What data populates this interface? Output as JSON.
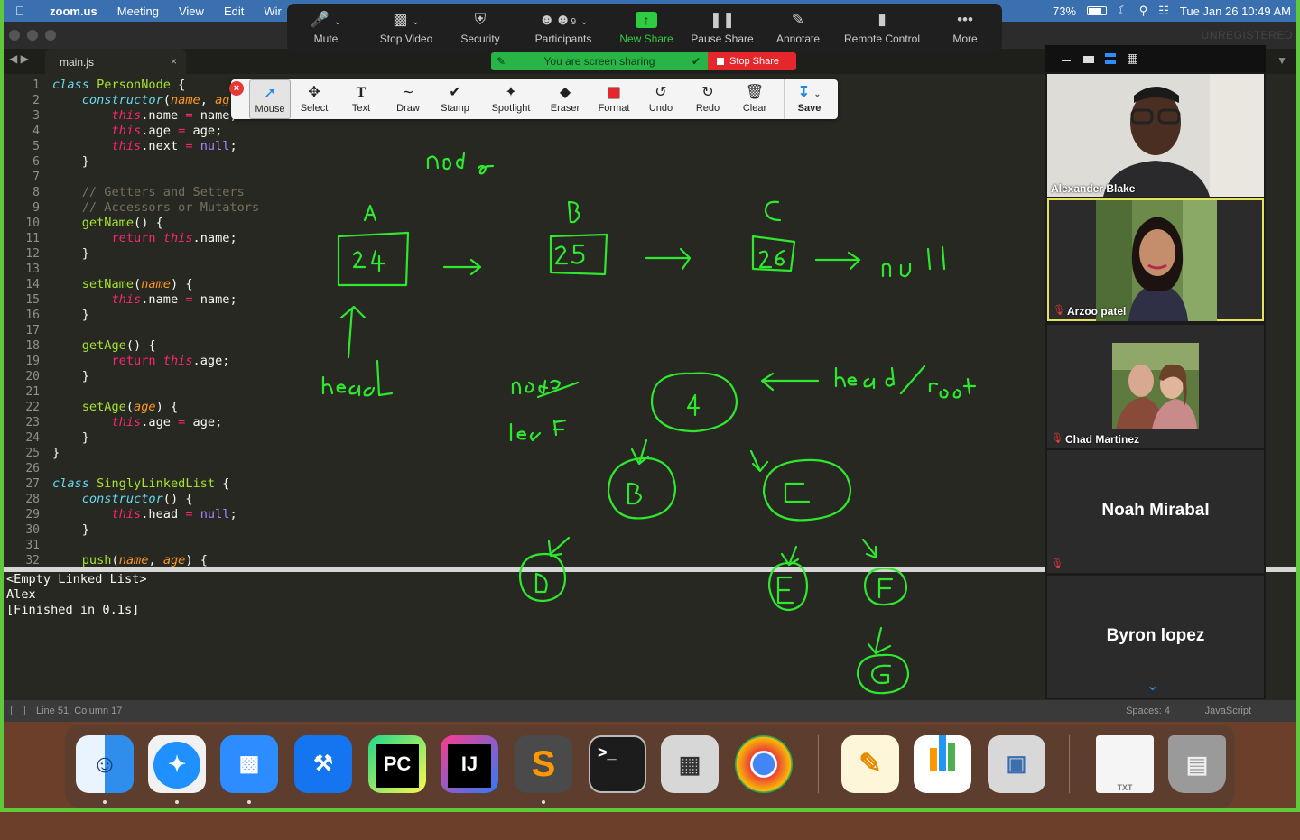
{
  "menubar": {
    "app": "zoom.us",
    "items": [
      "Meeting",
      "View",
      "Edit",
      "Wir"
    ],
    "battery": "73%",
    "datetime": "Tue Jan 26  10:49 AM"
  },
  "editor": {
    "tab": "main.js",
    "unregistered": "UNREGISTERED",
    "line_numbers": [
      "1",
      "2",
      "3",
      "4",
      "5",
      "6",
      "7",
      "8",
      "9",
      "10",
      "11",
      "12",
      "13",
      "14",
      "15",
      "16",
      "17",
      "18",
      "19",
      "20",
      "21",
      "22",
      "23",
      "24",
      "25",
      "26",
      "27",
      "28",
      "29",
      "30",
      "31",
      "32"
    ],
    "console": [
      "<Empty Linked List>",
      "Alex",
      "[Finished in 0.1s]"
    ],
    "status": {
      "position": "Line 51, Column 17",
      "spaces": "Spaces: 4",
      "language": "JavaScript"
    }
  },
  "zoom_toolbar": {
    "buttons": [
      {
        "label": "Mute",
        "icon": "microphone-icon"
      },
      {
        "label": "Stop Video",
        "icon": "video-camera-icon"
      },
      {
        "label": "Security",
        "icon": "shield-icon"
      },
      {
        "label": "Participants",
        "icon": "people-icon",
        "count": "9"
      },
      {
        "label": "New Share",
        "icon": "share-up-arrow-icon"
      },
      {
        "label": "Pause Share",
        "icon": "pause-icon"
      },
      {
        "label": "Annotate",
        "icon": "pencil-icon"
      },
      {
        "label": "Remote Control",
        "icon": "mouse-icon"
      },
      {
        "label": "More",
        "icon": "more-dots-icon"
      }
    ],
    "sharing_banner": "You are screen sharing",
    "stop_share": "Stop Share",
    "accent_green": "#2ecc40",
    "stop_red": "#e5262a"
  },
  "annotate_toolbar": {
    "tools": [
      {
        "label": "Mouse",
        "icon": "cursor-icon"
      },
      {
        "label": "Select",
        "icon": "move-icon"
      },
      {
        "label": "Text",
        "icon": "text-icon"
      },
      {
        "label": "Draw",
        "icon": "squiggle-icon"
      },
      {
        "label": "Stamp",
        "icon": "check-icon"
      },
      {
        "label": "Spotlight",
        "icon": "wand-icon"
      },
      {
        "label": "Eraser",
        "icon": "eraser-icon"
      },
      {
        "label": "Format",
        "icon": "red-square-icon"
      },
      {
        "label": "Undo",
        "icon": "undo-icon"
      },
      {
        "label": "Redo",
        "icon": "redo-icon"
      },
      {
        "label": "Clear",
        "icon": "trash-icon"
      },
      {
        "label": "Save",
        "icon": "save-icon"
      }
    ]
  },
  "participants": [
    {
      "name": "Alexander Blake",
      "video": true
    },
    {
      "name": "Arzoo patel",
      "video": true,
      "muted": true,
      "active_speaker": true
    },
    {
      "name": "Chad Martinez",
      "video": true,
      "muted": true
    },
    {
      "name": "Noah Mirabal",
      "video": false,
      "muted": true
    },
    {
      "name": "Byron lopez",
      "video": false
    }
  ],
  "ink_color": "#2ee82e",
  "dock": {
    "apps": [
      "Finder",
      "Safari",
      "Zoom",
      "Xcode",
      "PyCharm",
      "IntelliJ IDEA",
      "Sublime Text",
      "Terminal",
      "Calculator",
      "Chrome",
      "Pages",
      "Numbers",
      "Preview",
      "TXT",
      "Trash"
    ],
    "pycharm_label": "PC",
    "intellij_label": "IJ",
    "terminal_label": ">_",
    "txt_label": "TXT"
  }
}
